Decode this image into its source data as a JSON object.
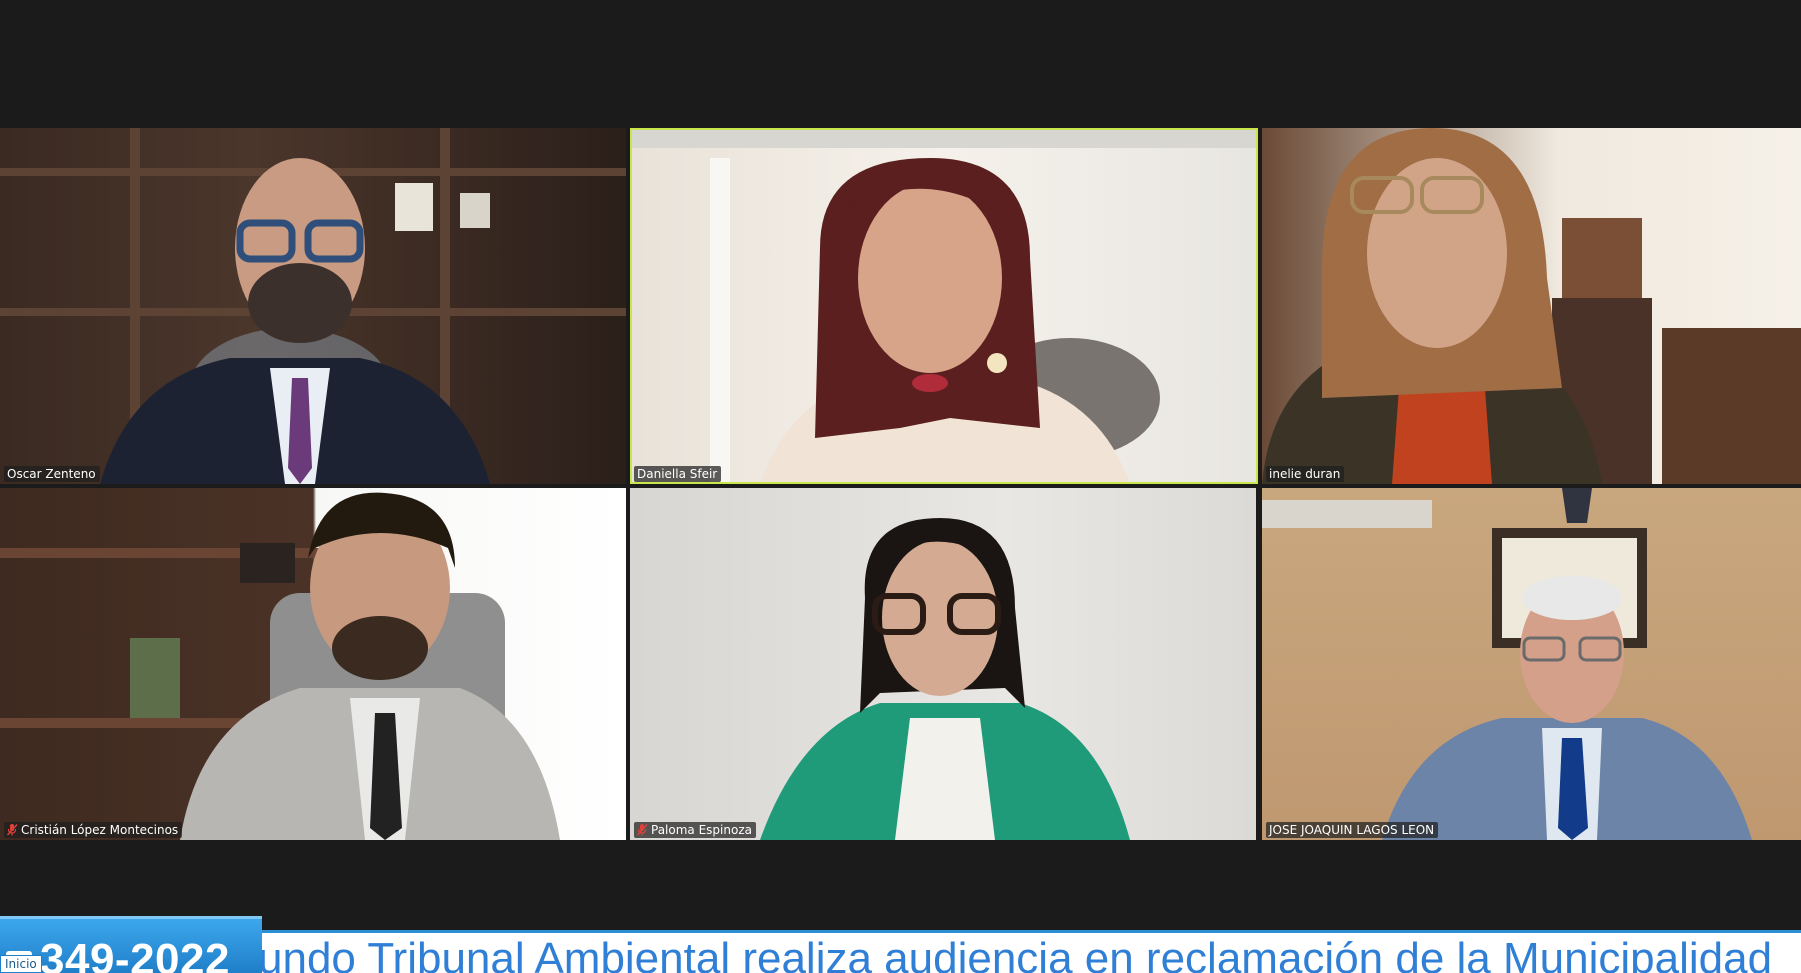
{
  "participants": [
    {
      "name": "Oscar Zenteno",
      "muted": false,
      "active": false
    },
    {
      "name": "Daniella Sfeir",
      "muted": false,
      "active": true
    },
    {
      "name": "inelie duran",
      "muted": false,
      "active": false
    },
    {
      "name": "Cristián López Montecinos",
      "muted": true,
      "active": false
    },
    {
      "name": "Paloma Espinoza",
      "muted": true,
      "active": false
    },
    {
      "name": "JOSE JOAQUIN LAGOS LEON",
      "muted": false,
      "active": false
    }
  ],
  "ticker": {
    "case_number": "349-2022",
    "inicio_label": "Inicio",
    "headline": "undo Tribunal Ambiental realiza audiencia en reclamación de la Municipalidad"
  },
  "colors": {
    "active_speaker_border": "#c9e64a",
    "ticker_accent": "#2d8fd6",
    "ticker_text": "#2f7fd6",
    "muted_mic": "#e0403a"
  }
}
